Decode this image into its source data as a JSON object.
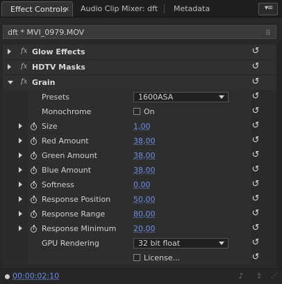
{
  "tabs": [
    {
      "label": "Effect Controls",
      "active": true,
      "close": "×"
    },
    {
      "label": "Audio Clip Mixer: dft",
      "active": false
    },
    {
      "label": "Metadata",
      "active": false
    }
  ],
  "panel_menu_icon": "panel-menu-icon",
  "clip_header": {
    "name": "dft * MVI_0979.MOV"
  },
  "fx_glyph": "fx",
  "effects": {
    "glow": {
      "label": "Glow Effects",
      "expanded": false
    },
    "hdtv": {
      "label": "HDTV Masks",
      "expanded": false
    },
    "grain": {
      "label": "Grain",
      "expanded": true
    }
  },
  "grain_params": {
    "presets": {
      "label": "Presets",
      "value": "1600ASA"
    },
    "monochrome": {
      "label": "Monochrome",
      "checkbox_label": "On",
      "checked": false
    },
    "size": {
      "label": "Size",
      "value": "1,00"
    },
    "red_amount": {
      "label": "Red Amount",
      "value": "38,00"
    },
    "green_amount": {
      "label": "Green Amount",
      "value": "38,00"
    },
    "blue_amount": {
      "label": "Blue Amount",
      "value": "38,00"
    },
    "softness": {
      "label": "Softness",
      "value": "0,00"
    },
    "response_position": {
      "label": "Response Position",
      "value": "50,00"
    },
    "response_range": {
      "label": "Response Range",
      "value": "80,00"
    },
    "response_minimum": {
      "label": "Response Minimum",
      "value": "20,00"
    },
    "gpu_rendering": {
      "label": "GPU Rendering",
      "value": "32 bit float"
    },
    "license": {
      "checkbox_label": "License...",
      "checked": false
    }
  },
  "reset_glyph": "↺",
  "bottom": {
    "timecode": "00:00:02:10"
  },
  "colors": {
    "accent_value": "#6e8fe6",
    "panel_bg": "#282828"
  }
}
